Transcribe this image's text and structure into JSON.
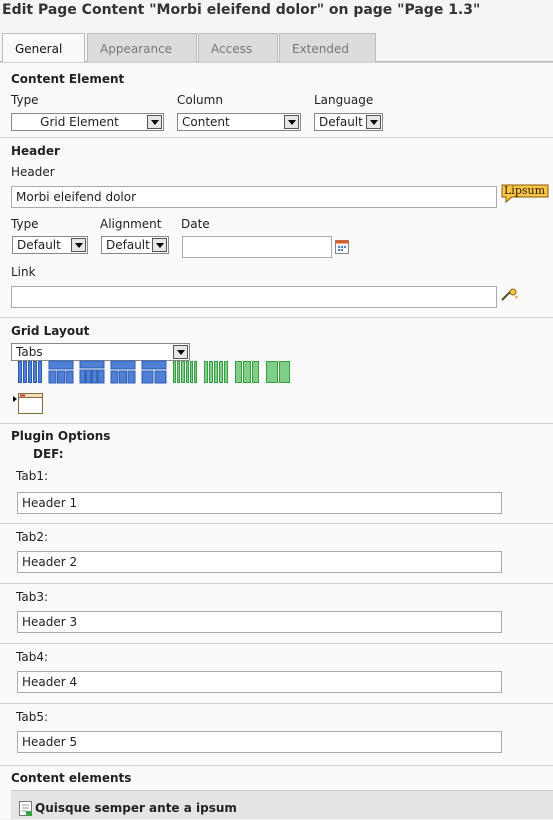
{
  "page_title": "Edit Page Content \"Morbi eleifend dolor\" on page \"Page 1.3\"",
  "tabs": [
    {
      "label": "General"
    },
    {
      "label": "Appearance"
    },
    {
      "label": "Access"
    },
    {
      "label": "Extended"
    }
  ],
  "content_element": {
    "title": "Content Element",
    "type_label": "Type",
    "type_value": "Grid Element",
    "column_label": "Column",
    "column_value": "Content",
    "language_label": "Language",
    "language_value": "Default"
  },
  "header_section": {
    "title": "Header",
    "header_label": "Header",
    "header_value": "Morbi eleifend dolor",
    "lipsum_label": "Lipsum",
    "type_label": "Type",
    "type_value": "Default",
    "alignment_label": "Alignment",
    "alignment_value": "Default",
    "date_label": "Date",
    "date_value": "",
    "link_label": "Link",
    "link_value": ""
  },
  "grid_layout": {
    "title": "Grid Layout",
    "selected": "Tabs"
  },
  "plugin_options": {
    "title": "Plugin Options",
    "subtitle": "DEF:",
    "tabs": [
      {
        "label": "Tab1:",
        "value": "Header 1"
      },
      {
        "label": "Tab2:",
        "value": "Header 2"
      },
      {
        "label": "Tab3:",
        "value": "Header 3"
      },
      {
        "label": "Tab4:",
        "value": "Header 4"
      },
      {
        "label": "Tab5:",
        "value": "Header 5"
      }
    ]
  },
  "content_elements": {
    "title": "Content elements",
    "first_item": "Quisque semper ante a ipsum"
  },
  "colors": {
    "grid_blue": "#4f80d6",
    "grid_green": "#7fcf86",
    "lipsum_badge": "#f5c64a"
  }
}
